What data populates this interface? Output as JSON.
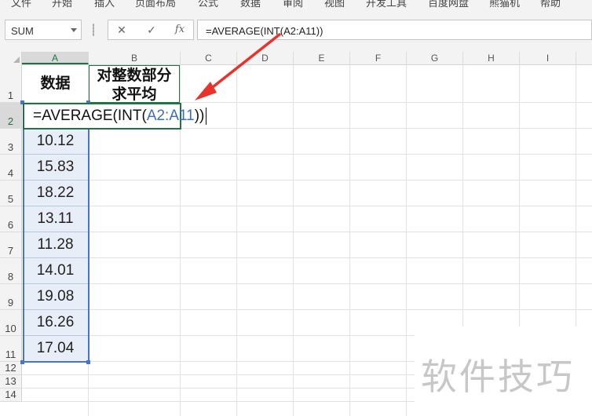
{
  "ribbon": {
    "tabs": [
      "文件",
      "开始",
      "插入",
      "页面布局",
      "公式",
      "数据",
      "审阅",
      "视图",
      "开发工具",
      "百度网盘",
      "熊猫机",
      "帮助"
    ]
  },
  "formula_bar": {
    "name_box_value": "SUM",
    "cancel_glyph": "✕",
    "enter_glyph": "✓",
    "fx_glyph": "fx",
    "formula_text": "=AVERAGE(INT(A2:A11))"
  },
  "sheet": {
    "columns": [
      "A",
      "B",
      "C",
      "D",
      "E",
      "F",
      "G",
      "H",
      "I"
    ],
    "rows": [
      "1",
      "2",
      "3",
      "4",
      "5",
      "6",
      "7",
      "8",
      "9",
      "10",
      "11",
      "12",
      "13",
      "14"
    ],
    "A1": "数据",
    "B1_line1": "对整数部分",
    "B1_line2": "求平均",
    "A2_edit_prefix": "=AVERAGE(INT(",
    "A2_edit_ref": "A2:A11",
    "A2_edit_suffix": "))",
    "data_values": [
      "10.12",
      "15.83",
      "18.22",
      "13.11",
      "11.28",
      "14.01",
      "19.08",
      "16.26",
      "17.04"
    ]
  },
  "watermark_text": "软件技巧",
  "colors": {
    "accent_green": "#217346",
    "range_blue": "#4a74c4",
    "arrow_red": "#e8322b",
    "selection_fill": "#e7eef8"
  }
}
